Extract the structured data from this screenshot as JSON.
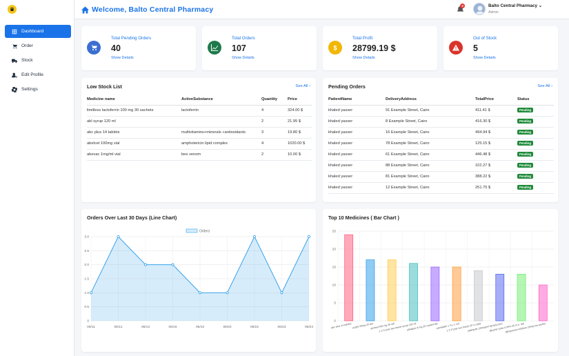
{
  "header": {
    "welcome": "Welcome, Balto Central Pharmacy",
    "user_name": "Balto Central Pharmacy",
    "user_role": "Admin",
    "notif_count": "3"
  },
  "sidebar": {
    "items": [
      {
        "label": "Dashboard",
        "icon": "dashboard-icon",
        "active": true
      },
      {
        "label": "Order",
        "icon": "cart-icon"
      },
      {
        "label": "Stock",
        "icon": "truck-icon"
      },
      {
        "label": "Edit Profile",
        "icon": "user-edit-icon"
      },
      {
        "label": "Settings",
        "icon": "gear-icon"
      }
    ]
  },
  "stats": [
    {
      "label": "Total Pending Orders",
      "value": "40",
      "link": "Show Details",
      "color": "#3b6fd1",
      "icon": "cart-icon"
    },
    {
      "label": "Total Orders",
      "value": "107",
      "link": "Show Details",
      "color": "#1f7a4a",
      "icon": "chart-line-icon"
    },
    {
      "label": "Total Profit",
      "value": "28799.19 $",
      "link": "Show Details",
      "color": "#f2b705",
      "icon": "dollar-icon"
    },
    {
      "label": "Out of Stock",
      "value": "5",
      "link": "Show Details",
      "color": "#d9342b",
      "icon": "warning-icon"
    }
  ],
  "low_stock": {
    "title": "Low Stock List",
    "see_all": "See All",
    "columns": [
      "Medicine name",
      "ActiveSubstance",
      "Quantity",
      "Price"
    ],
    "rows": [
      [
        "limitless lactoferrin 100 mg 30 sachets",
        "lactoferrin",
        "4",
        "324.00 $"
      ],
      [
        "abl syrup 120 ml",
        "",
        "2",
        "21.95 $"
      ],
      [
        "abc plus 14 tablets",
        "multivitamins+minerals +antioxidants",
        "3",
        "19.80 $"
      ],
      [
        "abelcet 100mg vial",
        "amphotericin lipid complex",
        "4",
        "1020.00 $"
      ],
      [
        "abevac 1mg/ml vial",
        "bee venom",
        "2",
        "10.00 $"
      ]
    ]
  },
  "pending_orders": {
    "title": "Pending Orders",
    "see_all": "See All",
    "columns": [
      "PatientName",
      "DeliveryAddress",
      "TotalPrice",
      "Status"
    ],
    "rows": [
      [
        "khaled yasser",
        "91 Example Street, Cairo",
        "411.41 $",
        "Pending"
      ],
      [
        "khaled yasser",
        "8 Example Street, Cairo",
        "416.30 $",
        "Pending"
      ],
      [
        "khaled yasser",
        "16 Example Street, Cairo",
        "494.94 $",
        "Pending"
      ],
      [
        "khaled yasser",
        "78 Example Street, Cairo",
        "125.15 $",
        "Pending"
      ],
      [
        "khaled yasser",
        "61 Example Street, Cairo",
        "446.48 $",
        "Pending"
      ],
      [
        "khaled yasser",
        "88 Example Street, Cairo",
        "102.27 $",
        "Pending"
      ],
      [
        "khaled yasser",
        "81 Example Street, Cairo",
        "388.22 $",
        "Pending"
      ],
      [
        "khaled yasser",
        "12 Example Street, Cairo",
        "251.75 $",
        "Pending"
      ]
    ]
  },
  "line_panel": {
    "title": "Orders Over Last 30 Days (Line Chart)"
  },
  "bar_panel": {
    "title": "Top 10 Medicines ( Bar Chart )"
  },
  "chart_data": [
    {
      "type": "line",
      "title": "Orders Over Last 30 Days (Line Chart)",
      "x": [
        "06/11",
        "06/12",
        "06/13",
        "06/15",
        "06/16",
        "06/20",
        "06/22",
        "06/23",
        "06/24"
      ],
      "series": [
        {
          "name": "Orders",
          "values": [
            1,
            3,
            2,
            2,
            1,
            1,
            3,
            1,
            3
          ]
        }
      ],
      "ylim": [
        0,
        3
      ],
      "yticks": [
        "0",
        "0.5",
        "1.0",
        "1.5",
        "2.0",
        "2.5",
        "3.0"
      ],
      "grid": true,
      "legend": "top",
      "color": "#36a2eb"
    },
    {
      "type": "bar",
      "title": "Top 10 Medicines ( Bar Chart )",
      "categories": [
        "abc plus 14 tablets",
        "acipril 20mg 20 tab",
        "alzheal 500 mg 20 tab",
        "1 2 3 (one two three) syrup 120 ml",
        "althalore 8 mg 20 coated tab",
        "pamalatin 1 % i.v. sol",
        "1 2 3 (one two three) 20 f.c.tabs",
        "aldehyde 125mg/ml syrup(a pet)",
        "alkyrine nose 0.05% 25 m.e. tab",
        "allosporium infolene 20mg ora sachet"
      ],
      "values": [
        24,
        17,
        17,
        16,
        15,
        15,
        14,
        13,
        13,
        10
      ],
      "colors": [
        "#ff6384",
        "#36a2eb",
        "#ffcd56",
        "#4bc0c0",
        "#9966ff",
        "#ff9f40",
        "#c9cbcf",
        "#5b6cf0",
        "#77ee77",
        "#ff66cc"
      ],
      "ylim": [
        0,
        25
      ],
      "yticks": [
        "0",
        "5",
        "10",
        "15",
        "20",
        "25"
      ]
    }
  ]
}
